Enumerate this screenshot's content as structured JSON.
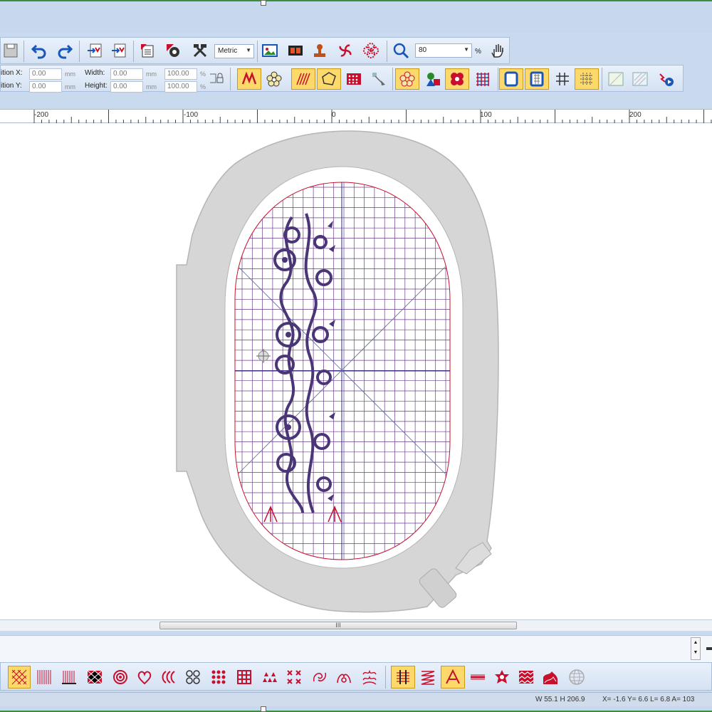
{
  "window": {
    "brand_color": "#c6d7ee",
    "accent": "#fdd96b"
  },
  "toolbar_top": {
    "units_value": "Metric",
    "zoom_value": "80",
    "zoom_unit": "%",
    "icons": [
      "save-icon",
      "undo-icon",
      "redo-icon",
      "import-icon",
      "export-icon",
      "properties-icon",
      "settings-icon",
      "tools-icon",
      "picture-icon",
      "film-icon",
      "stamp-icon",
      "pinwheel-icon",
      "flower-icon",
      "zoom-icon",
      "hand-pan-icon"
    ]
  },
  "toolbar_props": {
    "pos_x_label": "ition X:",
    "pos_y_label": "ition Y:",
    "pos_x_value": "0.00",
    "pos_y_value": "0.00",
    "width_label": "Width:",
    "height_label": "Height:",
    "width_value": "0.00",
    "height_value": "0.00",
    "scale_w_value": "100.00",
    "scale_h_value": "100.00",
    "unit_mm": "mm",
    "unit_pct": "%"
  },
  "ruler": {
    "labels": [
      "-200",
      "-100",
      "0",
      "100",
      "200"
    ]
  },
  "status": {
    "size": "W  55.1 H 206.9",
    "coords": "X=  -1.6 Y=   6.6 L=    6.8 A= 103"
  },
  "scroll_grip": "III",
  "colors": {
    "design": "#4a3577",
    "grid_line": "#6b3b8a",
    "hoop_border": "#c8102e",
    "hoop_frame": "#d6d6d6",
    "axis": "#1d2a8a"
  }
}
